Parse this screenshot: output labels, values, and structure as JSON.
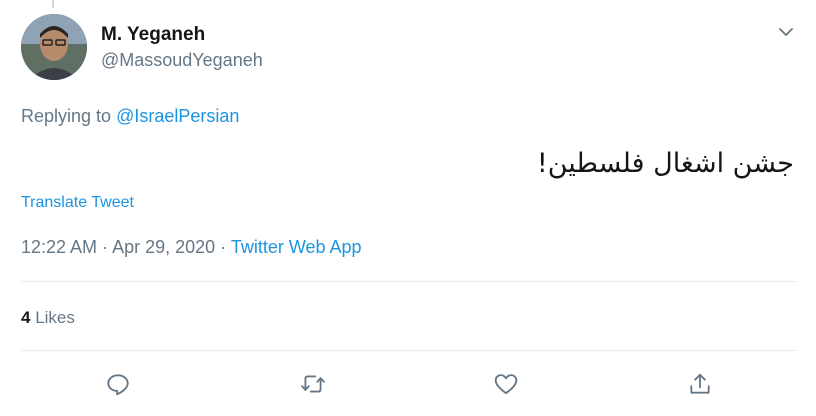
{
  "tweet": {
    "display_name": "M. Yeganeh",
    "handle": "@MassoudYeganeh",
    "replying_prefix": "Replying to ",
    "replying_to": "@IsraelPersian",
    "text": "جشن اشغال فلسطین!",
    "translate_label": "Translate Tweet",
    "time": "12:22 AM",
    "separator": " · ",
    "date": "Apr 29, 2020",
    "source": "Twitter Web App",
    "likes_count": "4",
    "likes_label": " Likes"
  },
  "icons": {
    "caret": "chevron-down-icon",
    "reply": "reply-icon",
    "retweet": "retweet-icon",
    "like": "heart-icon",
    "share": "share-icon"
  },
  "colors": {
    "link": "#1b95e0",
    "secondary_text": "#657786",
    "primary_text": "#14171a",
    "divider": "#e6ecf0"
  }
}
